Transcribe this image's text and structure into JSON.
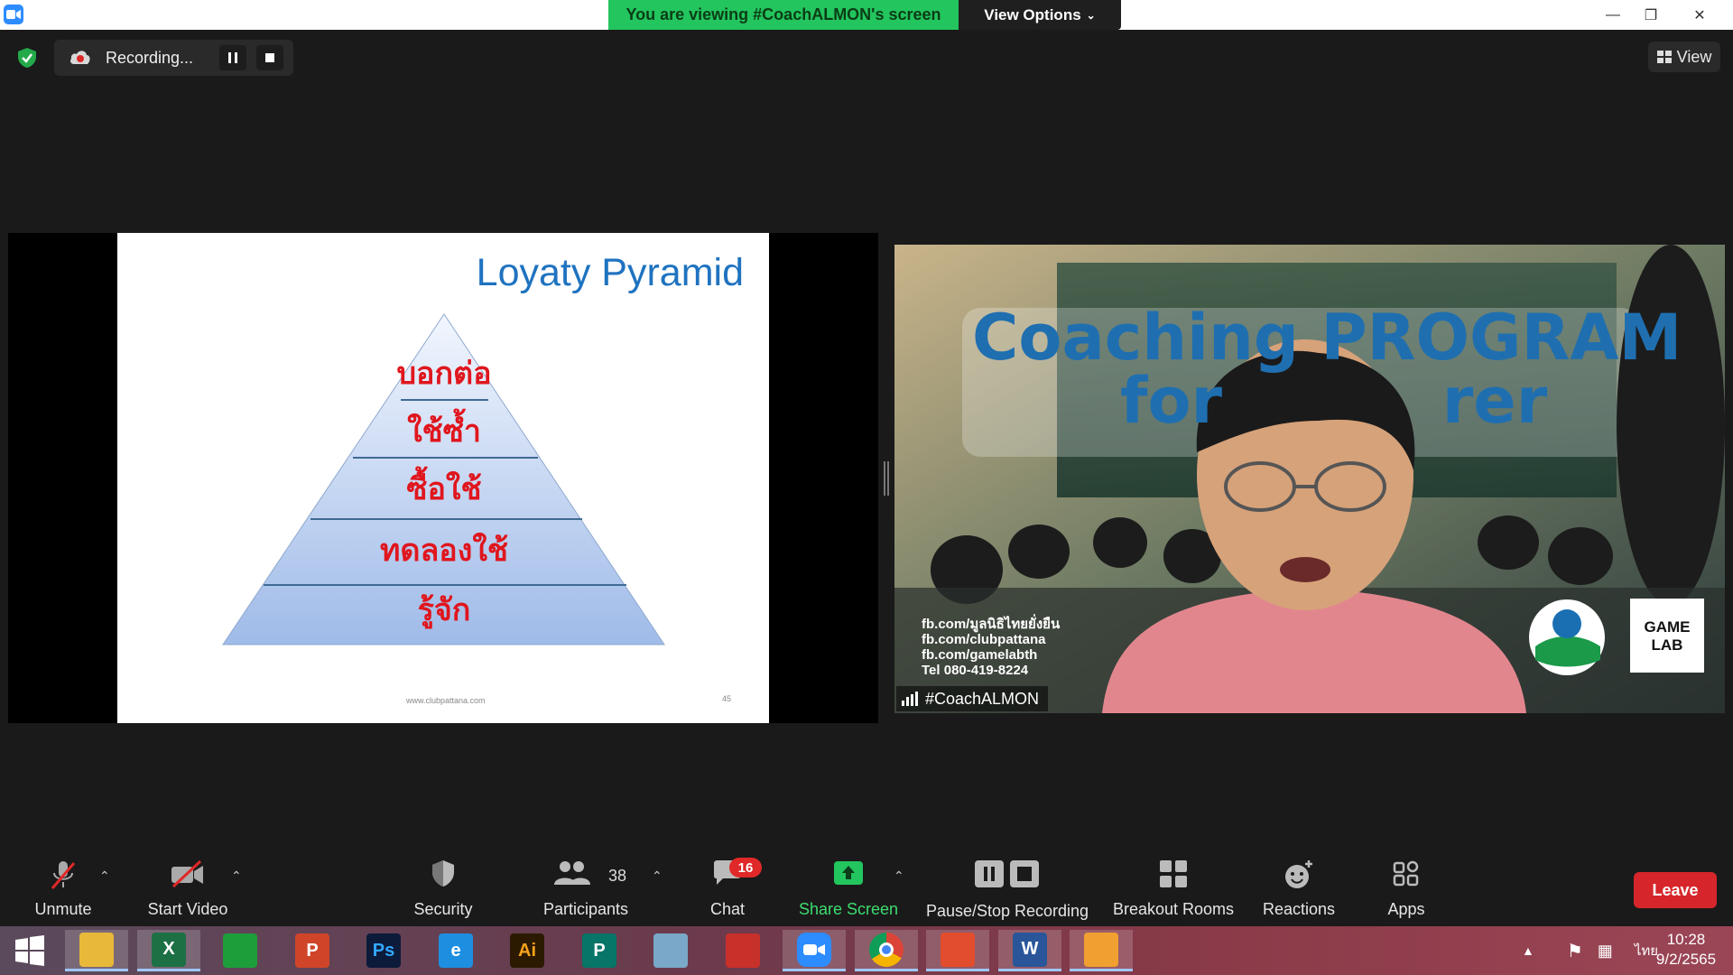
{
  "titlebar": {
    "banner": "You are viewing #CoachALMON's screen",
    "view_options": "View Options"
  },
  "recording": {
    "label": "Recording..."
  },
  "view_button": {
    "label": "View"
  },
  "slide": {
    "title": "Loyaty Pyramid",
    "levels": [
      "บอกต่อ",
      "ใช้ซ้ำ",
      "ซื้อใช้",
      "ทดลองใช้",
      "รู้จัก"
    ],
    "footer": "www.clubpattana.com",
    "page_number": "45"
  },
  "video": {
    "participant_name": "#CoachALMON",
    "backdrop_line1": "Coaching PROGRAM",
    "backdrop_line2": "for          rer",
    "contacts": [
      "fb.com/มูลนิธิไทยยั่งยืน",
      "fb.com/clubpattana",
      "fb.com/gamelabth",
      "Tel 080-419-8224"
    ],
    "logo_text": "GAME LAB"
  },
  "toolbar": {
    "unmute": "Unmute",
    "start_video": "Start Video",
    "security": "Security",
    "participants": "Participants",
    "participants_count": "38",
    "chat": "Chat",
    "chat_badge": "16",
    "share_screen": "Share Screen",
    "pause_stop": "Pause/Stop Recording",
    "breakout": "Breakout Rooms",
    "reactions": "Reactions",
    "apps": "Apps",
    "leave": "Leave"
  },
  "taskbar": {
    "apps": [
      {
        "name": "file-explorer",
        "label": "",
        "color": "#e8b83a"
      },
      {
        "name": "excel",
        "label": "X",
        "color": "#1d7044"
      },
      {
        "name": "store",
        "label": "",
        "color": "#1e9e3a"
      },
      {
        "name": "powerpoint",
        "label": "P",
        "color": "#d0452a"
      },
      {
        "name": "photoshop",
        "label": "Ps",
        "color": "#0c1b3a"
      },
      {
        "name": "internet-explorer",
        "label": "e",
        "color": "#1e8fe0"
      },
      {
        "name": "illustrator",
        "label": "Ai",
        "color": "#2b1a00"
      },
      {
        "name": "publisher",
        "label": "P",
        "color": "#077568"
      },
      {
        "name": "pencil-app",
        "label": "",
        "color": "#7aa8c8"
      },
      {
        "name": "photoscape",
        "label": "",
        "color": "#c8302a"
      },
      {
        "name": "zoom",
        "label": "",
        "color": "#2d8cff"
      },
      {
        "name": "chrome",
        "label": "",
        "color": "#e8e8e8"
      },
      {
        "name": "office",
        "label": "",
        "color": "#e24d2d"
      },
      {
        "name": "word",
        "label": "W",
        "color": "#2a5699"
      },
      {
        "name": "photo-viewer",
        "label": "",
        "color": "#f0a030"
      }
    ],
    "language": "ไทย",
    "time": "10:28",
    "date": "9/2/2565"
  },
  "colors": {
    "banner_green": "#23c55e",
    "share_green": "#23c55e",
    "leave_red": "#d6262b",
    "chat_badge_red": "#e02828",
    "slide_title_blue": "#1f73c0",
    "pyramid_text_red": "#e0161e"
  }
}
